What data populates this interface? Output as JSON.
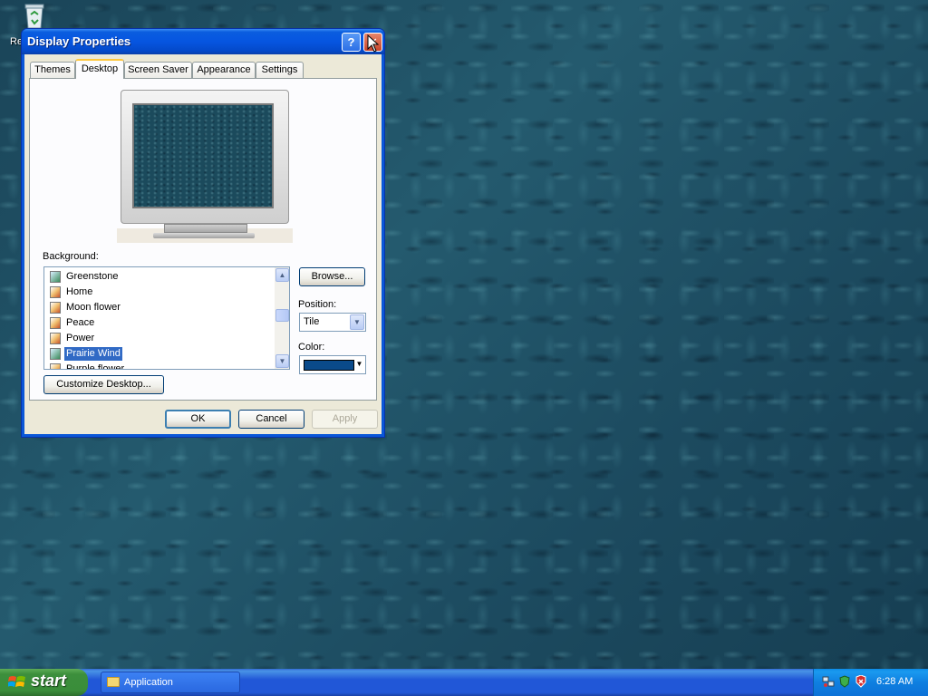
{
  "desktop": {
    "icon_label": "Re"
  },
  "window": {
    "title": "Display Properties",
    "help_glyph": "?",
    "close_glyph": "✕",
    "tabs": [
      {
        "label": "Themes"
      },
      {
        "label": "Desktop"
      },
      {
        "label": "Screen Saver"
      },
      {
        "label": "Appearance"
      },
      {
        "label": "Settings"
      }
    ],
    "active_tab": "Desktop",
    "background_label": "Background:",
    "background_items": [
      {
        "label": "Greenstone"
      },
      {
        "label": "Home"
      },
      {
        "label": "Moon flower"
      },
      {
        "label": "Peace"
      },
      {
        "label": "Power"
      },
      {
        "label": "Prairie Wind"
      },
      {
        "label": "Purple flower"
      }
    ],
    "selected_background": "Prairie Wind",
    "browse_button": "Browse...",
    "position_label": "Position:",
    "position_value": "Tile",
    "color_label": "Color:",
    "color_value": "#0a4a8a",
    "customize_button": "Customize Desktop...",
    "ok_button": "OK",
    "cancel_button": "Cancel",
    "apply_button": "Apply"
  },
  "taskbar": {
    "start_label": "start",
    "task_button": "Application",
    "clock": "6:28 AM"
  }
}
